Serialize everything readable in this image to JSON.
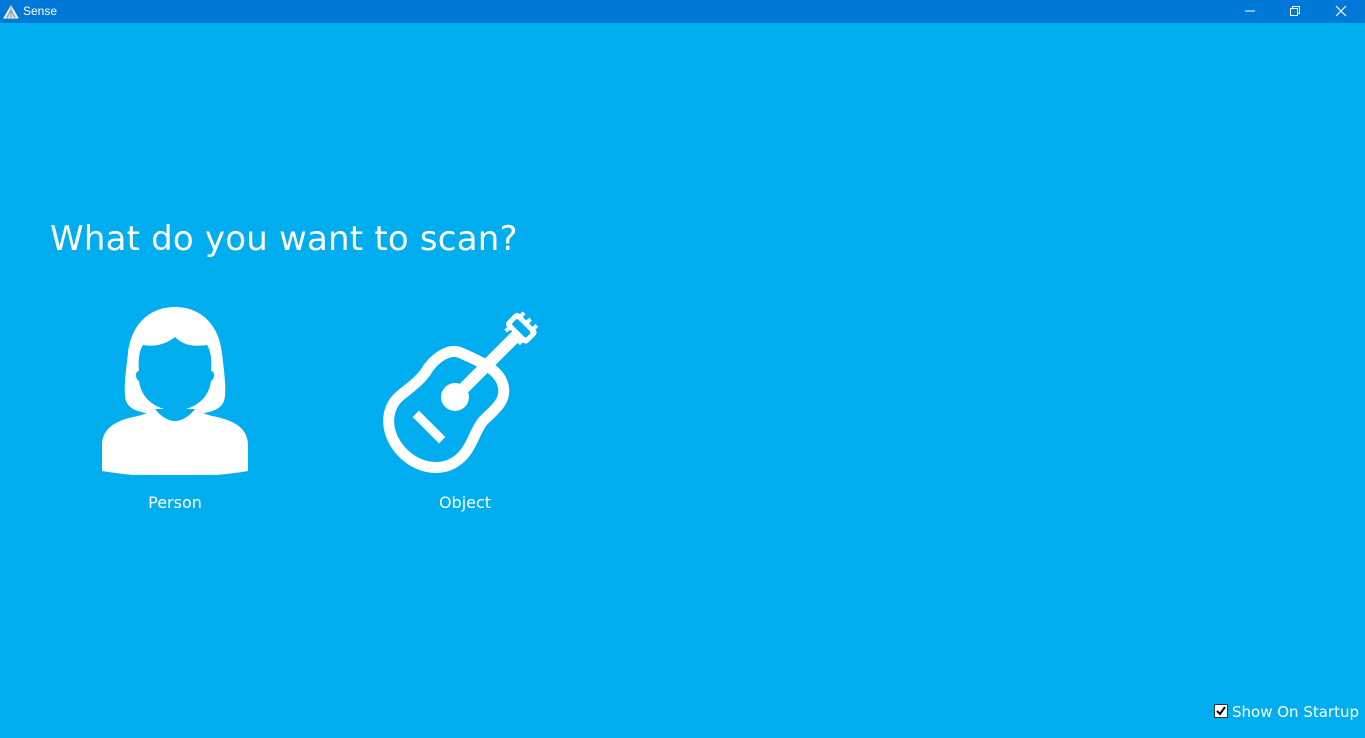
{
  "window": {
    "title": "Sense",
    "titlebar_color": "#0078d7",
    "background_color": "#00adef",
    "controls": [
      "minimize-icon",
      "restore-icon",
      "close-icon"
    ]
  },
  "main": {
    "heading": "What do you want to scan?",
    "options": [
      {
        "label": "Person",
        "icon": "person-icon"
      },
      {
        "label": "Object",
        "icon": "guitar-icon"
      }
    ]
  },
  "footer": {
    "show_on_startup_label": "Show On Startup",
    "show_on_startup_checked": true
  }
}
